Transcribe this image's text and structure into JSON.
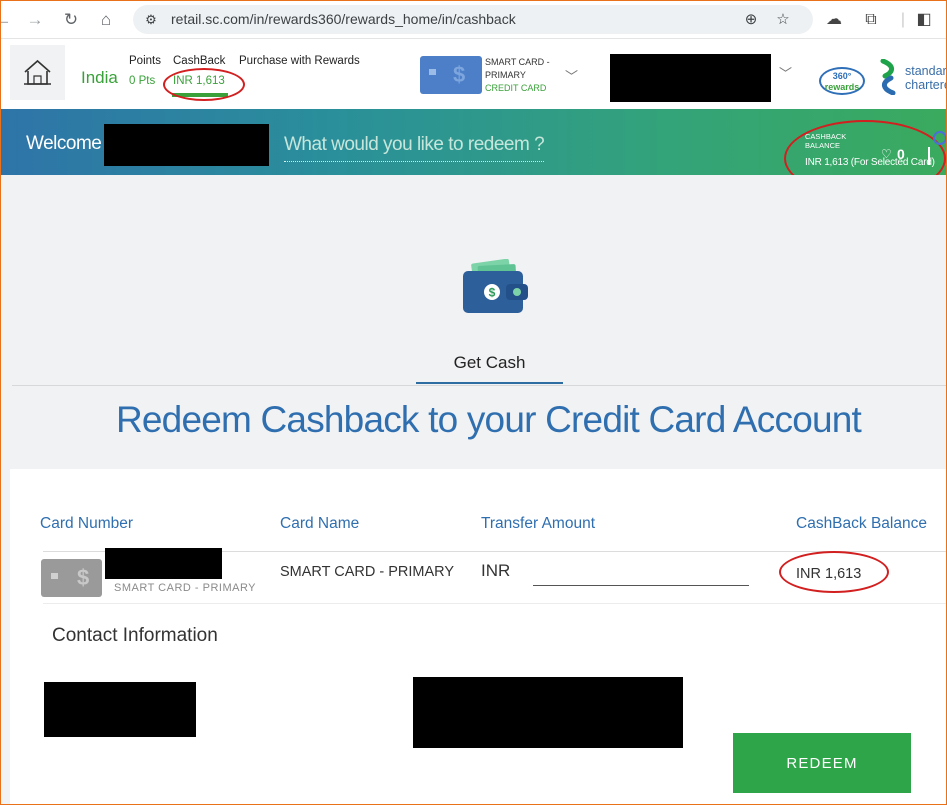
{
  "browser": {
    "url": "retail.sc.com/in/rewards360/rewards_home/in/cashback"
  },
  "header": {
    "country": "India",
    "points_label": "Points",
    "points_value": "0 Pts",
    "cashback_label": "CashBack",
    "cashback_value": "INR 1,613",
    "purchase_label": "Purchase with Rewards",
    "card_line1": "SMART CARD -",
    "card_line2": "PRIMARY",
    "card_line3": "CREDIT CARD",
    "rewards_logo_line1": "360°",
    "rewards_logo_line2": "rewards",
    "brand_line1": "standard",
    "brand_line2": "chartered"
  },
  "welcome_band": {
    "welcome_text": "Welcome",
    "search_prompt": "What would you like to redeem ?",
    "cb_balance_label_line1": "CASHBACK",
    "cb_balance_label_line2": "BALANCE",
    "cb_balance_value": "INR 1,613  (For Selected Card)",
    "wishlist_count": "0"
  },
  "main": {
    "tab_label": "Get Cash",
    "headline": "Redeem Cashback to your Credit Card Account",
    "table": {
      "headers": [
        "Card Number",
        "Card Name",
        "Transfer Amount",
        "CashBack Balance"
      ],
      "row": {
        "card_sub_label": "SMART CARD - PRIMARY",
        "card_name": "SMART CARD - PRIMARY",
        "currency": "INR",
        "amount_value": "",
        "balance": "INR 1,613"
      }
    },
    "contact_title": "Contact Information",
    "redeem_label": "REDEEM"
  },
  "colors": {
    "brand_blue": "#2f6fb0",
    "brand_green": "#3aa13a",
    "button_green": "#2ea548",
    "annotation_red": "#d21f1f"
  }
}
